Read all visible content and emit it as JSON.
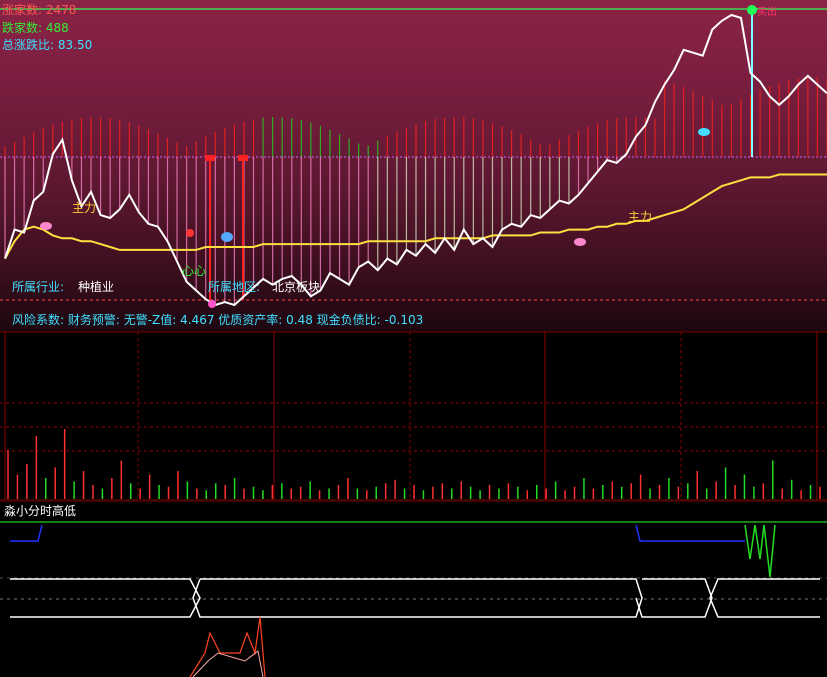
{
  "stats": {
    "up_label": "涨家数",
    "up_value": "2478",
    "down_label": "跌家数",
    "down_value": "488",
    "ratio_label": "总涨跌比",
    "ratio_value": "83.50"
  },
  "info": {
    "industry_label": "所属行业:",
    "industry_value": "种植业",
    "region_label": "所属地区:",
    "region_value": "北京板块",
    "risk_text": "风险系数: 财务预警: 无警-Z值: 4.467 优质资产率: 0.48 现金负债比: -0.103"
  },
  "annotations": {
    "zhuli_1": "主力",
    "zhuli_2": "主力",
    "xin": "心心",
    "top_mark": "卖出"
  },
  "indicator3": {
    "title": "淼小分时高低"
  },
  "colors": {
    "white_line": "#ffffff",
    "yellow_line": "#ffe040",
    "up_bar": "#ff3030",
    "down_bar": "#22dd22",
    "cyan_text": "#40e0ff",
    "grid": "#8a0000"
  },
  "chart_data": [
    {
      "type": "line",
      "series": [
        {
          "values": [
            0.16,
            0.26,
            0.25,
            0.36,
            0.39,
            0.52,
            0.57,
            0.43,
            0.34,
            0.39,
            0.31,
            0.3,
            0.33,
            0.38,
            0.32,
            0.28,
            0.27,
            0.22,
            0.15,
            0.08,
            0.05,
            0.02,
            0.0,
            0.01,
            0.0,
            0.03,
            0.06,
            0.09,
            0.07,
            0.09,
            0.1,
            0.07,
            0.03,
            0.05,
            0.11,
            0.09,
            0.07,
            0.13,
            0.15,
            0.12,
            0.16,
            0.14,
            0.19,
            0.17,
            0.21,
            0.18,
            0.23,
            0.19,
            0.26,
            0.21,
            0.23,
            0.2,
            0.26,
            0.28,
            0.27,
            0.31,
            0.3,
            0.33,
            0.36,
            0.35,
            0.38,
            0.42,
            0.46,
            0.5,
            0.49,
            0.52,
            0.58,
            0.62,
            0.7,
            0.76,
            0.81,
            0.88,
            0.87,
            0.86,
            0.95,
            0.98,
            1.0,
            0.99,
            0.8,
            0.77,
            0.72,
            0.69,
            0.72,
            0.76,
            0.79,
            0.76,
            0.73
          ]
        },
        {
          "values": [
            0.16,
            0.22,
            0.26,
            0.27,
            0.26,
            0.24,
            0.23,
            0.23,
            0.22,
            0.22,
            0.21,
            0.2,
            0.19,
            0.19,
            0.19,
            0.19,
            0.19,
            0.19,
            0.19,
            0.19,
            0.19,
            0.2,
            0.2,
            0.2,
            0.2,
            0.2,
            0.2,
            0.21,
            0.21,
            0.21,
            0.21,
            0.21,
            0.21,
            0.21,
            0.21,
            0.21,
            0.21,
            0.21,
            0.22,
            0.22,
            0.22,
            0.22,
            0.22,
            0.22,
            0.22,
            0.23,
            0.23,
            0.23,
            0.23,
            0.23,
            0.23,
            0.24,
            0.24,
            0.24,
            0.24,
            0.24,
            0.25,
            0.25,
            0.25,
            0.26,
            0.26,
            0.26,
            0.27,
            0.27,
            0.28,
            0.28,
            0.29,
            0.29,
            0.3,
            0.31,
            0.32,
            0.33,
            0.35,
            0.37,
            0.39,
            0.41,
            0.42,
            0.43,
            0.44,
            0.44,
            0.44,
            0.45,
            0.45,
            0.45,
            0.45,
            0.45,
            0.45
          ]
        }
      ]
    },
    {
      "type": "bar",
      "values": [
        28,
        14,
        20,
        36,
        12,
        18,
        40,
        10,
        16,
        8,
        6,
        12,
        22,
        9,
        6,
        14,
        8,
        7,
        16,
        10,
        6,
        5,
        9,
        8,
        12,
        6,
        7,
        5,
        8,
        9,
        6,
        7,
        10,
        5,
        6,
        8,
        12,
        6,
        5,
        7,
        9,
        11,
        6,
        8,
        5,
        7,
        9,
        6,
        10,
        7,
        5,
        8,
        6,
        9,
        7,
        5,
        8,
        6,
        10,
        5,
        7,
        12,
        6,
        8,
        10,
        7,
        9,
        14,
        6,
        8,
        12,
        7,
        9,
        16,
        6,
        10,
        18,
        8,
        14,
        7,
        9,
        22,
        6,
        11,
        5,
        8,
        7
      ],
      "colors": [
        "u",
        "u",
        "u",
        "u",
        "d",
        "u",
        "u",
        "d",
        "u",
        "u",
        "d",
        "u",
        "u",
        "d",
        "u",
        "u",
        "d",
        "u",
        "u",
        "d",
        "u",
        "d",
        "d",
        "u",
        "d",
        "u",
        "d",
        "d",
        "u",
        "d",
        "u",
        "u",
        "d",
        "u",
        "d",
        "u",
        "u",
        "d",
        "u",
        "d",
        "u",
        "u",
        "d",
        "u",
        "d",
        "u",
        "u",
        "d",
        "u",
        "d",
        "d",
        "u",
        "d",
        "u",
        "d",
        "u",
        "d",
        "u",
        "d",
        "u",
        "u",
        "d",
        "u",
        "d",
        "u",
        "d",
        "u",
        "u",
        "d",
        "u",
        "d",
        "u",
        "d",
        "u",
        "d",
        "u",
        "d",
        "u",
        "d",
        "d",
        "u",
        "d",
        "u",
        "d",
        "u",
        "d",
        "u"
      ]
    }
  ]
}
